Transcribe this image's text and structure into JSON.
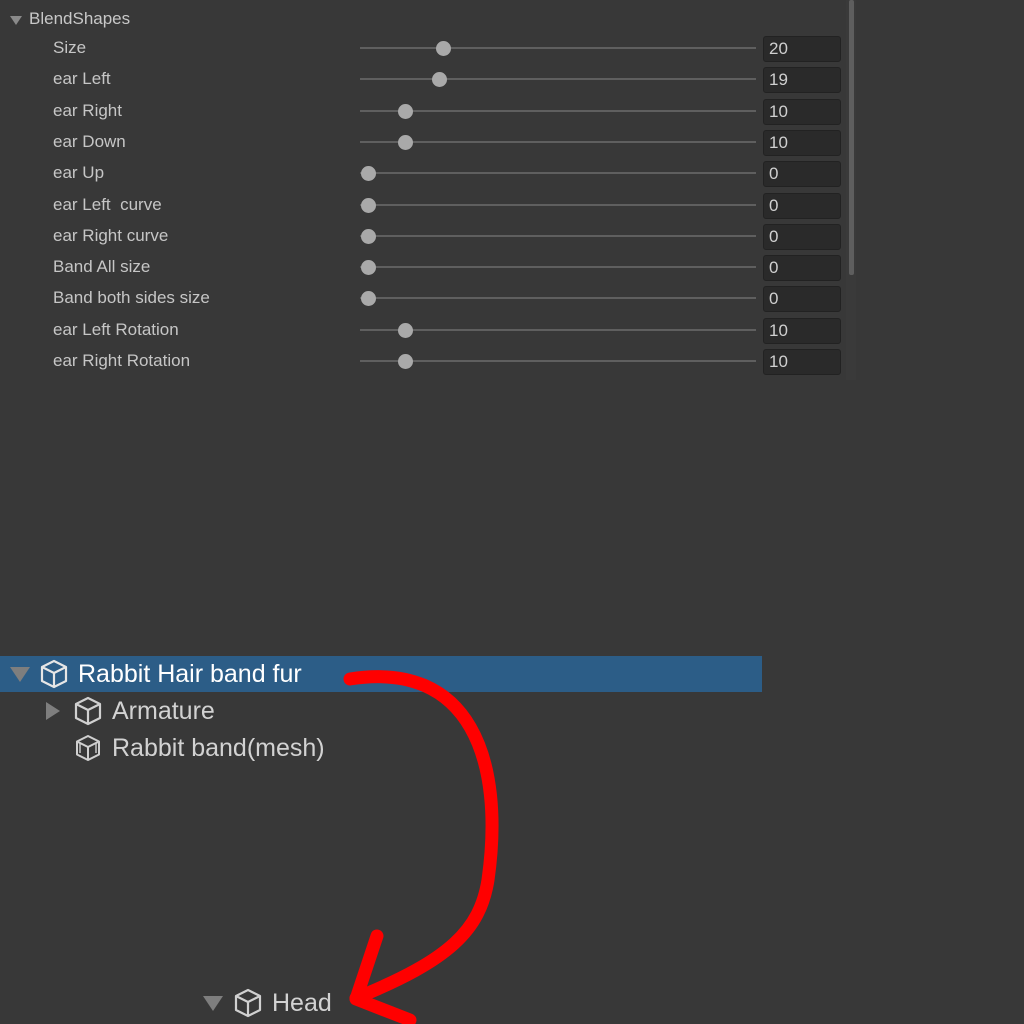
{
  "inspector": {
    "section_title": "BlendShapes",
    "blendshapes": [
      {
        "label": "Size",
        "value": "20"
      },
      {
        "label": "ear Left",
        "value": "19"
      },
      {
        "label": "ear Right",
        "value": "10"
      },
      {
        "label": "ear Down",
        "value": "10"
      },
      {
        "label": "ear Up",
        "value": "0"
      },
      {
        "label": "ear Left  curve",
        "value": "0"
      },
      {
        "label": "ear Right curve",
        "value": "0"
      },
      {
        "label": "Band All size",
        "value": "0"
      },
      {
        "label": "Band both sides size",
        "value": "0"
      },
      {
        "label": "ear Left Rotation",
        "value": "10"
      },
      {
        "label": "ear Right Rotation",
        "value": "10"
      }
    ]
  },
  "hierarchy": {
    "root": {
      "label": "Rabbit Hair band fur",
      "icon": "cube-icon",
      "expanded": true,
      "selected": true
    },
    "children": [
      {
        "label": "Armature",
        "icon": "cube-icon",
        "expanded": false
      },
      {
        "label": "Rabbit band(mesh)",
        "icon": "mesh-cube-icon"
      }
    ],
    "target": {
      "label": "Head",
      "icon": "cube-icon",
      "expanded": true
    }
  },
  "annotation": {
    "type": "drag-arrow",
    "color": "#ff0000",
    "from": "Rabbit Hair band fur",
    "to": "Head"
  },
  "colors": {
    "background": "#383838",
    "selection": "#2c5d87",
    "field": "#2a2a2a",
    "arrow": "#ff0000"
  }
}
